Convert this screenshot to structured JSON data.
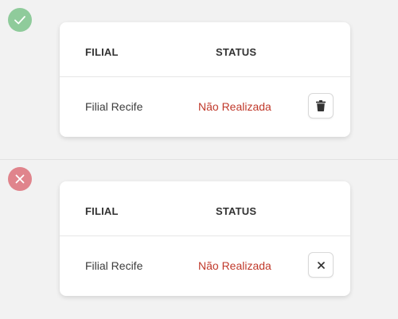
{
  "sections": [
    {
      "status_icon": "check-icon",
      "status_color": "#8fcb9b",
      "table": {
        "headers": {
          "filial": "FILIAL",
          "status": "STATUS"
        },
        "row": {
          "filial": "Filial Recife",
          "status": "Não Realizada"
        }
      },
      "action_icon": "trash-icon"
    },
    {
      "status_icon": "close-icon",
      "status_color": "#e0848c",
      "table": {
        "headers": {
          "filial": "FILIAL",
          "status": "STATUS"
        },
        "row": {
          "filial": "Filial Recife",
          "status": "Não Realizada"
        }
      },
      "action_icon": "close-icon"
    }
  ],
  "colors": {
    "status_text": "#c0392b",
    "background": "#f2f2f2"
  }
}
